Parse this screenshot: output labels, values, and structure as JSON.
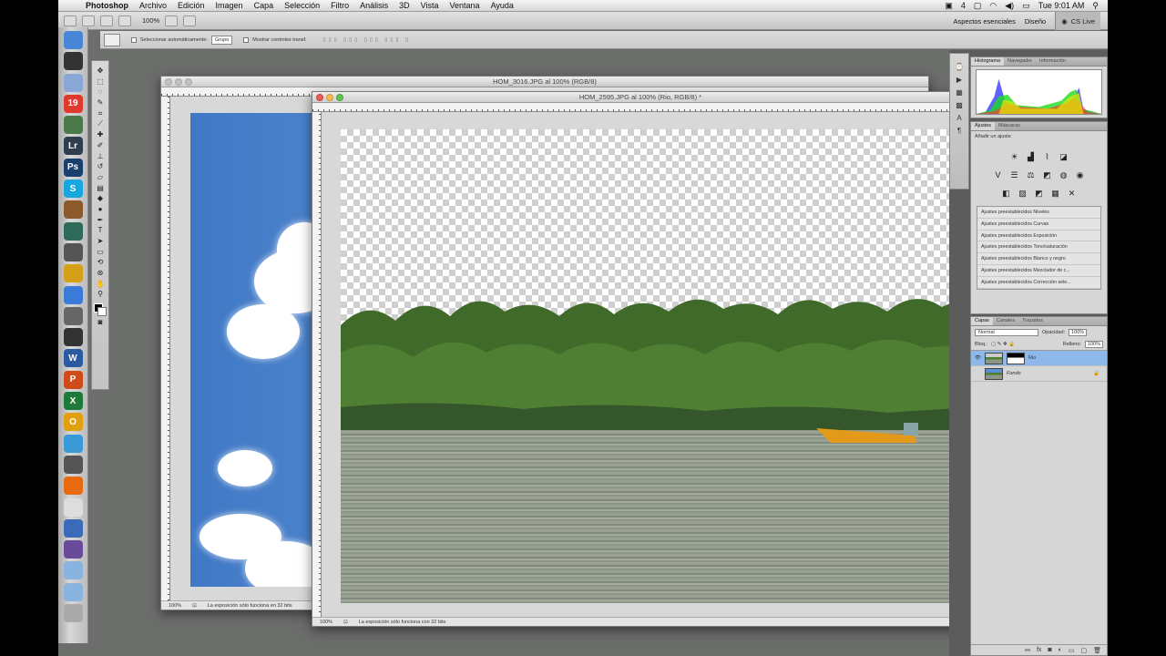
{
  "menubar": {
    "app_name": "Photoshop",
    "menus": [
      "Archivo",
      "Edición",
      "Imagen",
      "Capa",
      "Selección",
      "Filtro",
      "Análisis",
      "3D",
      "Vista",
      "Ventana",
      "Ayuda"
    ],
    "status_number": "4",
    "clock": "Tue 9:01 AM"
  },
  "appbar": {
    "zoom": "100%",
    "workspace_essentials": "Aspectos esenciales",
    "workspace_design": "Diseño",
    "cs_live": "CS Live"
  },
  "options": {
    "auto_select_label": "Seleccionar automáticamente:",
    "auto_select_value": "Grupo",
    "show_controls_label": "Mostrar controles transf."
  },
  "dock": {
    "icons": [
      {
        "name": "finder-icon",
        "label": "",
        "color": "#4a86d8"
      },
      {
        "name": "dashboard-icon",
        "label": "",
        "color": "#333333"
      },
      {
        "name": "mail-icon",
        "label": "",
        "color": "#8aa8d6"
      },
      {
        "name": "ical-icon",
        "label": "19",
        "color": "#e03a2f"
      },
      {
        "name": "iphoto-icon",
        "label": "",
        "color": "#4a7a4a"
      },
      {
        "name": "lightroom-icon",
        "label": "Lr",
        "color": "#2e3e4e"
      },
      {
        "name": "photoshop-icon",
        "label": "Ps",
        "color": "#1a3f6e"
      },
      {
        "name": "skype-icon",
        "label": "S",
        "color": "#16a7e0"
      },
      {
        "name": "garageband-icon",
        "label": "",
        "color": "#8a5a2a"
      },
      {
        "name": "time-machine-icon",
        "label": "",
        "color": "#2e6a5a"
      },
      {
        "name": "aperture-icon",
        "label": "",
        "color": "#555555"
      },
      {
        "name": "chrome-icon",
        "label": "",
        "color": "#d4a017"
      },
      {
        "name": "itunes-icon",
        "label": "",
        "color": "#3a7ad8"
      },
      {
        "name": "preview-icon",
        "label": "",
        "color": "#666666"
      },
      {
        "name": "finalcut-icon",
        "label": "",
        "color": "#333333"
      },
      {
        "name": "word-icon",
        "label": "W",
        "color": "#2c5aa0"
      },
      {
        "name": "powerpoint-icon",
        "label": "P",
        "color": "#d04a1a"
      },
      {
        "name": "excel-icon",
        "label": "X",
        "color": "#1e7a3a"
      },
      {
        "name": "outlook-icon",
        "label": "O",
        "color": "#e0a010"
      },
      {
        "name": "messenger-icon",
        "label": "",
        "color": "#3a9ad8"
      },
      {
        "name": "utilities-icon",
        "label": "",
        "color": "#555555"
      },
      {
        "name": "firefox-icon",
        "label": "",
        "color": "#e86a10"
      },
      {
        "name": "textedit-icon",
        "label": "",
        "color": "#dddddd"
      },
      {
        "name": "photo-booth-icon",
        "label": "",
        "color": "#3a6ab8"
      },
      {
        "name": "imovie-icon",
        "label": "",
        "color": "#6a4a9a"
      },
      {
        "name": "applications-folder-icon",
        "label": "",
        "color": "#8ab4e0"
      },
      {
        "name": "documents-folder-icon",
        "label": "",
        "color": "#8ab4e0"
      },
      {
        "name": "trash-icon",
        "label": "",
        "color": "#aaaaaa"
      }
    ]
  },
  "doc_back": {
    "title": "HOM_3016.JPG al 100% (RGB/8)",
    "zoom": "100%",
    "status": "La exposición sólo funciona en 32 bits"
  },
  "doc_front": {
    "title": "HOM_2595.JPG al 100% (Rio, RGB/8) *",
    "zoom": "100%",
    "status": "La exposición sólo funciona con 32 bits"
  },
  "panels": {
    "histogram_tabs": [
      "Histograma",
      "Navegador",
      "Información"
    ],
    "adjust_tabs": [
      "Ajustes",
      "Máscaras"
    ],
    "adjust_heading": "Añadir un ajuste",
    "presets": [
      "Ajustes preestablecidos Niveles",
      "Ajustes preestablecidos Curvas",
      "Ajustes preestablecidos Exposición",
      "Ajustes preestablecidos Tono/saturación",
      "Ajustes preestablecidos Blanco y negro",
      "Ajustes preestablecidos Mezclador de c...",
      "Ajustes preestablecidos Corrección sele..."
    ],
    "layers_tabs": [
      "Capas",
      "Canales",
      "Trazados"
    ],
    "blend_mode": "Normal",
    "opacity_label": "Opacidad:",
    "opacity_value": "100%",
    "lock_label": "Bloq.:",
    "fill_label": "Relleno:",
    "fill_value": "100%",
    "layers": [
      {
        "name": "Rio",
        "selected": true
      },
      {
        "name": "Fondo",
        "selected": false
      }
    ]
  }
}
